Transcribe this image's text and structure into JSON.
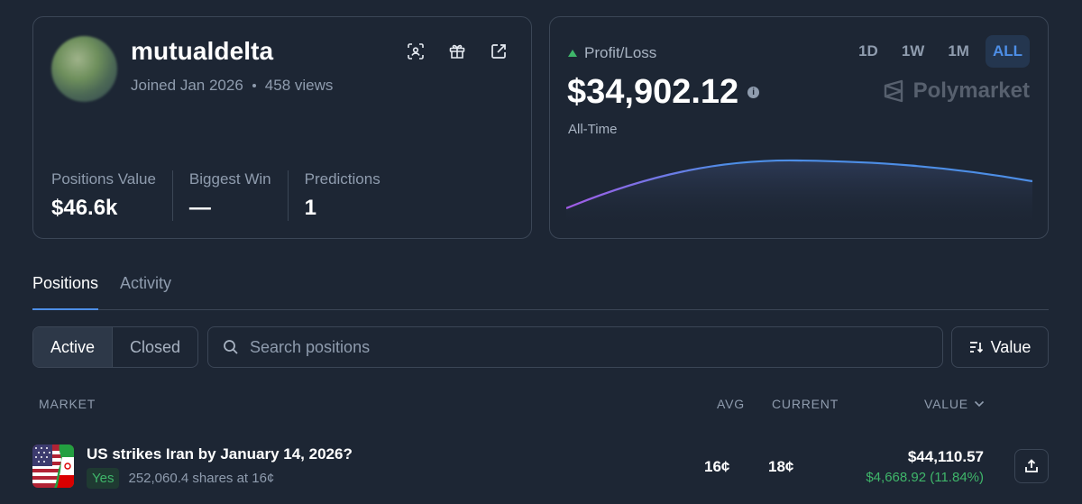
{
  "profile": {
    "username": "mutualdelta",
    "joined": "Joined Jan 2026",
    "views": "458 views",
    "icons": [
      "face-scan-icon",
      "gift-icon",
      "external-link-icon"
    ],
    "stats": [
      {
        "label": "Positions Value",
        "value": "$46.6k"
      },
      {
        "label": "Biggest Win",
        "value": "—"
      },
      {
        "label": "Predictions",
        "value": "1"
      }
    ]
  },
  "pnl": {
    "label": "Profit/Loss",
    "value": "$34,902.12",
    "period": "All-Time",
    "ranges": [
      "1D",
      "1W",
      "1M",
      "ALL"
    ],
    "active_range": "ALL",
    "brand": "Polymarket",
    "trend": "up",
    "colors": {
      "up": "#3fb66a",
      "line_start": "#9b5de5",
      "line_end": "#4d8ee6"
    }
  },
  "tabs": [
    {
      "label": "Positions",
      "active": true
    },
    {
      "label": "Activity",
      "active": false
    }
  ],
  "filters": {
    "active_label": "Active",
    "closed_label": "Closed",
    "search_placeholder": "Search positions",
    "sort_label": "Value"
  },
  "table": {
    "headers": {
      "market": "MARKET",
      "avg": "AVG",
      "current": "CURRENT",
      "value": "VALUE"
    },
    "rows": [
      {
        "title": "US strikes Iran by January 14, 2026?",
        "outcome": "Yes",
        "shares": "252,060.4 shares at 16¢",
        "avg": "16¢",
        "current": "18¢",
        "value": "$44,110.57",
        "pnl": "$4,668.92 (11.84%)"
      }
    ]
  }
}
